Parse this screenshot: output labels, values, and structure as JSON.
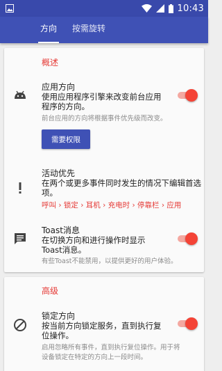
{
  "status_bar": {
    "time": "10:43",
    "icons": [
      "image-icon",
      "wifi-icon",
      "signal-icon",
      "battery-icon"
    ]
  },
  "tabs": [
    {
      "label": "方向",
      "active": true
    },
    {
      "label": "按需旋转",
      "active": false
    }
  ],
  "overview": {
    "header": "概述",
    "app_orientation": {
      "icon": "android-icon",
      "title": "应用方向",
      "summary_line1": "使用应用程序引擎来改变前台应用",
      "summary_line2": "程序的方向。",
      "hint": "前台应用的方向将根据事件优先级而改变。",
      "enabled": true
    },
    "permission_button": "需要权限",
    "event_priority": {
      "icon": "exclamation-icon",
      "title": "活动优先",
      "summary_line1": "在两个或更多事件同时发生的情况下编辑首选",
      "summary_line2": "项。",
      "chain": "呼叫 › 锁定 › 耳机 › 充电时 › 停靠栏 › 应用"
    },
    "toast": {
      "icon": "message-icon",
      "title": "Toast消息",
      "summary_line1": "在切换方向和进行操作时显示",
      "summary_line2": "Toast消息。",
      "hint": "有些Toast不能禁用，以提供更好的用户体验。",
      "enabled": true
    }
  },
  "advanced": {
    "header": "高级",
    "lock_orientation": {
      "icon": "block-icon",
      "title": "锁定方向",
      "summary_line1": "按当前方向锁定服务，直到执行复",
      "summary_line2": "位操作。",
      "hint_line1": "启用忽略所有事件，直到执行复位操作。用于将",
      "hint_line2": "设备锁定在特定的方向上一段时间。",
      "enabled": true
    }
  },
  "colors": {
    "primary": "#3f51b5",
    "primary_dark": "#3949ab",
    "accent": "#f44336",
    "section_header": "#e53935"
  }
}
